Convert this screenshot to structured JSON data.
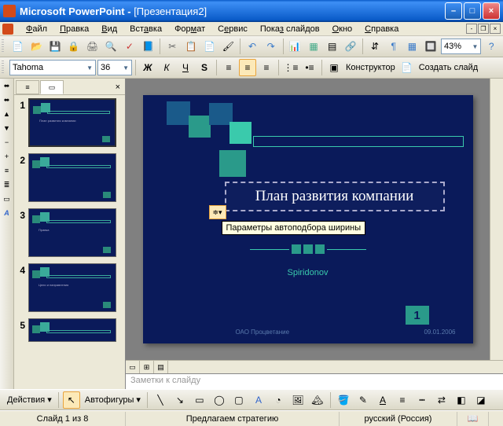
{
  "app": {
    "name": "Microsoft PowerPoint",
    "doc": "[Презентация2]"
  },
  "menus": [
    "Файл",
    "Правка",
    "Вид",
    "Вставка",
    "Формат",
    "Сервис",
    "Показ слайдов",
    "Окно",
    "Справка"
  ],
  "toolbar1": {
    "zoom": "43%"
  },
  "toolbar2": {
    "font": "Tahoma",
    "size": "36",
    "designer_label": "Конструктор",
    "newslide_label": "Создать слайд"
  },
  "thumbnails": [
    {
      "n": "1",
      "title": "План развития компании",
      "selected": true
    },
    {
      "n": "2",
      "title": ""
    },
    {
      "n": "3",
      "title": "Правка"
    },
    {
      "n": "4",
      "title": "Цели и направления"
    },
    {
      "n": "5",
      "title": ""
    }
  ],
  "slide": {
    "title": "План развития компании",
    "tooltip": "Параметры автоподбора ширины",
    "author": "Spiridonov",
    "company": "ОАО Процветание",
    "date": "09.01.2006",
    "page": "1"
  },
  "notes_placeholder": "Заметки к слайду",
  "drawbar": {
    "actions": "Действия",
    "autoshapes": "Автофигуры"
  },
  "status": {
    "slide": "Слайд 1 из 8",
    "mid": "Предлагаем стратегию",
    "lang": "русский (Россия)"
  }
}
